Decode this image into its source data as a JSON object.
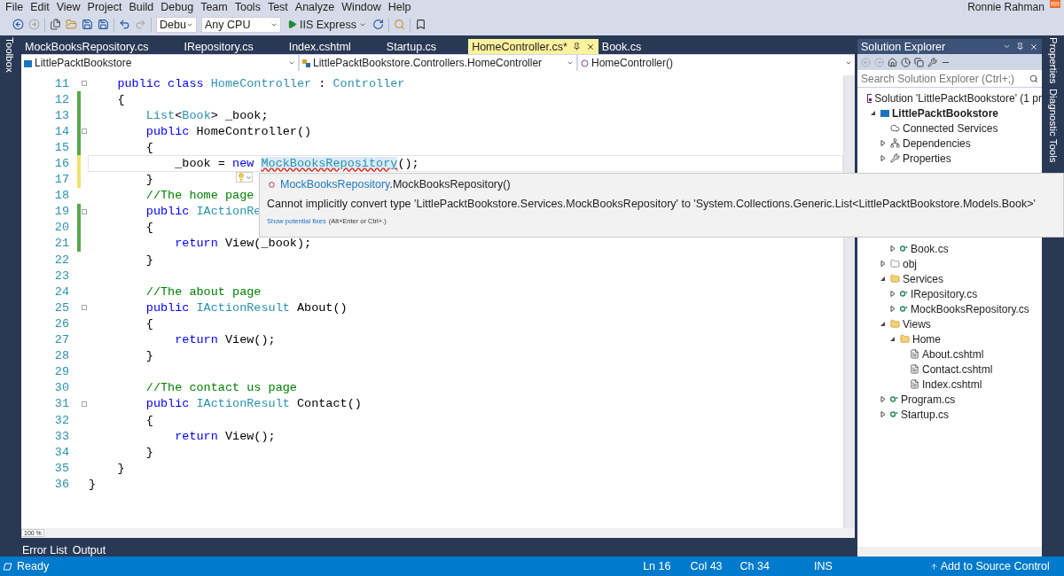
{
  "menu": [
    "File",
    "Edit",
    "View",
    "Project",
    "Build",
    "Debug",
    "Team",
    "Tools",
    "Test",
    "Analyze",
    "Window",
    "Help"
  ],
  "user": {
    "name": "Ronnie Rahman",
    "initials": "RR"
  },
  "toolbar": {
    "configuration": "Debu",
    "platform": "Any CPU",
    "run": "IIS Express"
  },
  "left_strip": [
    "Toolbox"
  ],
  "right_strip": [
    "Properties",
    "Diagnostic Tools"
  ],
  "document_tabs": [
    {
      "label": "MockBooksRepository.cs",
      "selected": false
    },
    {
      "label": "IRepository.cs",
      "selected": false
    },
    {
      "label": "Index.cshtml",
      "selected": false
    },
    {
      "label": "Startup.cs",
      "selected": false
    },
    {
      "label": "HomeController.cs*",
      "selected": true
    },
    {
      "label": "Book.cs",
      "selected": false
    }
  ],
  "navigation": {
    "project": "LittlePacktBookstore",
    "type": "LittlePacktBookstore.Controllers.HomeController",
    "member": "HomeController()"
  },
  "editor": {
    "zoom": "100 %",
    "lines": [
      {
        "number": "11",
        "changed": false,
        "fold": true,
        "current": false,
        "tokens": [
          {
            "kind": "keyword",
            "text": "    public"
          },
          {
            "kind": "keyword",
            "text": " class"
          },
          {
            "kind": "type",
            "text": " HomeController"
          },
          {
            "kind": "plain",
            "text": " :"
          },
          {
            "kind": "type",
            "text": " Controller"
          }
        ]
      },
      {
        "number": "12",
        "changed": true,
        "saved": true,
        "fold": false,
        "current": false,
        "tokens": [
          {
            "kind": "plain",
            "text": "    {"
          }
        ]
      },
      {
        "number": "13",
        "changed": true,
        "saved": true,
        "fold": false,
        "current": false,
        "tokens": [
          {
            "kind": "type",
            "text": "        List"
          },
          {
            "kind": "plain",
            "text": "<"
          },
          {
            "kind": "type",
            "text": "Book"
          },
          {
            "kind": "plain",
            "text": "> _book;"
          }
        ]
      },
      {
        "number": "14",
        "changed": true,
        "saved": true,
        "fold": true,
        "current": false,
        "tokens": [
          {
            "kind": "keyword",
            "text": "        public"
          },
          {
            "kind": "plain",
            "text": " HomeController()"
          }
        ]
      },
      {
        "number": "15",
        "changed": true,
        "saved": true,
        "fold": false,
        "current": false,
        "tokens": [
          {
            "kind": "plain",
            "text": "        {"
          }
        ]
      },
      {
        "number": "16",
        "changed": true,
        "saved": false,
        "fold": false,
        "current": true,
        "tokens": [
          {
            "kind": "plain",
            "text": "            _book ="
          },
          {
            "kind": "keyword",
            "text": " new "
          },
          {
            "kind": "error",
            "text": "MockBooksRepository"
          },
          {
            "kind": "plain",
            "text": "();"
          }
        ]
      },
      {
        "number": "17",
        "changed": true,
        "saved": false,
        "fold": false,
        "current": false,
        "tokens": [
          {
            "kind": "plain",
            "text": "        }"
          }
        ]
      },
      {
        "number": "18",
        "changed": false,
        "fold": false,
        "current": false,
        "tokens": [
          {
            "kind": "comment",
            "text": "        //The home page"
          }
        ]
      },
      {
        "number": "19",
        "changed": true,
        "saved": true,
        "fold": true,
        "current": false,
        "tokens": [
          {
            "kind": "keyword",
            "text": "        public"
          },
          {
            "kind": "type",
            "text": " IActionRe"
          }
        ]
      },
      {
        "number": "20",
        "changed": true,
        "saved": true,
        "fold": false,
        "current": false,
        "tokens": [
          {
            "kind": "plain",
            "text": "        {"
          }
        ]
      },
      {
        "number": "21",
        "changed": true,
        "saved": true,
        "fold": false,
        "current": false,
        "tokens": [
          {
            "kind": "keyword",
            "text": "            return"
          },
          {
            "kind": "plain",
            "text": " View(_book);"
          }
        ]
      },
      {
        "number": "22",
        "changed": false,
        "fold": false,
        "current": false,
        "tokens": [
          {
            "kind": "plain",
            "text": "        }"
          }
        ]
      },
      {
        "number": "23",
        "changed": false,
        "fold": false,
        "current": false
      },
      {
        "number": "24",
        "changed": false,
        "fold": false,
        "current": false,
        "tokens": [
          {
            "kind": "comment",
            "text": "        //The about page"
          }
        ]
      },
      {
        "number": "25",
        "changed": false,
        "fold": true,
        "current": false,
        "tokens": [
          {
            "kind": "keyword",
            "text": "        public"
          },
          {
            "kind": "type",
            "text": " IActionResult"
          },
          {
            "kind": "plain",
            "text": " About()"
          }
        ]
      },
      {
        "number": "26",
        "changed": false,
        "fold": false,
        "current": false,
        "tokens": [
          {
            "kind": "plain",
            "text": "        {"
          }
        ]
      },
      {
        "number": "27",
        "changed": false,
        "fold": false,
        "current": false,
        "tokens": [
          {
            "kind": "keyword",
            "text": "            return"
          },
          {
            "kind": "plain",
            "text": " View();"
          }
        ]
      },
      {
        "number": "28",
        "changed": false,
        "fold": false,
        "current": false,
        "tokens": [
          {
            "kind": "plain",
            "text": "        }"
          }
        ]
      },
      {
        "number": "29",
        "changed": false,
        "fold": false,
        "current": false
      },
      {
        "number": "30",
        "changed": false,
        "fold": false,
        "current": false,
        "tokens": [
          {
            "kind": "comment",
            "text": "        //The contact us page"
          }
        ]
      },
      {
        "number": "31",
        "changed": false,
        "fold": true,
        "current": false,
        "tokens": [
          {
            "kind": "keyword",
            "text": "        public"
          },
          {
            "kind": "type",
            "text": " IActionResult"
          },
          {
            "kind": "plain",
            "text": " Contact()"
          }
        ]
      },
      {
        "number": "32",
        "changed": false,
        "fold": false,
        "current": false,
        "tokens": [
          {
            "kind": "plain",
            "text": "        {"
          }
        ]
      },
      {
        "number": "33",
        "changed": false,
        "fold": false,
        "current": false,
        "tokens": [
          {
            "kind": "keyword",
            "text": "            return"
          },
          {
            "kind": "plain",
            "text": " View();"
          }
        ]
      },
      {
        "number": "34",
        "changed": false,
        "fold": false,
        "current": false,
        "tokens": [
          {
            "kind": "plain",
            "text": "        }"
          }
        ]
      },
      {
        "number": "35",
        "changed": false,
        "fold": false,
        "current": false,
        "tokens": [
          {
            "kind": "plain",
            "text": "    }"
          }
        ]
      },
      {
        "number": "36",
        "changed": false,
        "fold": false,
        "current": false,
        "tokens": [
          {
            "kind": "plain",
            "text": "}"
          }
        ]
      }
    ]
  },
  "quick_info": {
    "type": "MockBooksRepository",
    "member": ".MockBooksRepository()",
    "message": "Cannot implicitly convert type 'LittlePacktBookstore.Services.MockBooksRepository' to 'System.Collections.Generic.List<LittlePacktBookstore.Models.Book>'",
    "fix_link": "Show potential fixes",
    "fix_hint": "(Alt+Enter or Ctrl+.)"
  },
  "solution_explorer": {
    "title": "Solution Explorer",
    "search": {
      "placeholder": "Search Solution Explorer (Ctrl+;)"
    },
    "tree": [
      {
        "label": "Solution 'LittlePacktBookstore' (1 pr",
        "kind": "solution",
        "children": [
          {
            "label": "LittlePacktBookstore",
            "kind": "project",
            "expanded": true,
            "children": [
              {
                "label": "Connected Services",
                "kind": "connected"
              },
              {
                "label": "Dependencies",
                "kind": "dependencies",
                "expanded": false
              },
              {
                "label": "Properties",
                "kind": "properties",
                "expanded": false
              },
              {
                "kind": "covered",
                "children": [
                  {
                    "label": "Book.cs",
                    "kind": "cs",
                    "expanded": false
                  }
                ]
              },
              {
                "label": "obj",
                "kind": "excluded_folder",
                "expanded": false
              },
              {
                "label": "Services",
                "kind": "folder",
                "expanded": true,
                "children": [
                  {
                    "label": "IRepository.cs",
                    "kind": "cs",
                    "expanded": false
                  },
                  {
                    "label": "MockBooksRepository.cs",
                    "kind": "cs",
                    "expanded": false
                  }
                ]
              },
              {
                "label": "Views",
                "kind": "folder",
                "expanded": true,
                "children": [
                  {
                    "label": "Home",
                    "kind": "folder",
                    "expanded": true,
                    "children": [
                      {
                        "label": "About.cshtml",
                        "kind": "page"
                      },
                      {
                        "label": "Contact.cshtml",
                        "kind": "page"
                      },
                      {
                        "label": "Index.cshtml",
                        "kind": "page"
                      }
                    ]
                  }
                ]
              },
              {
                "label": "Program.cs",
                "kind": "cs",
                "expanded": false
              },
              {
                "label": "Startup.cs",
                "kind": "cs",
                "expanded": false
              }
            ]
          }
        ]
      }
    ]
  },
  "bottom_tabs": [
    "Error List",
    "Output"
  ],
  "status_bar": {
    "state": "Ready",
    "line": "Ln 16",
    "column": "Col 43",
    "char": "Ch 34",
    "mode": "INS",
    "source_control": "Add to Source Control"
  }
}
